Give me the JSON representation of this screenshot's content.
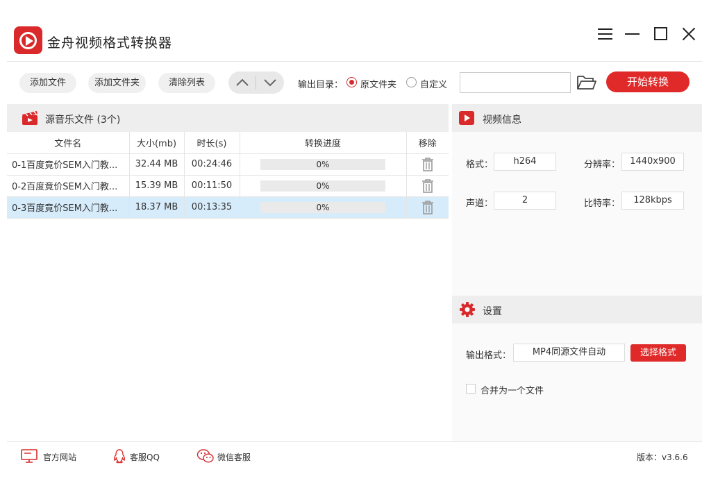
{
  "app": {
    "title": "金舟视频格式转换器"
  },
  "toolbar": {
    "add_file": "添加文件",
    "add_folder": "添加文件夹",
    "clear_list": "清除列表",
    "output_dir_label": "输出目录：",
    "radio_original": "原文件夹",
    "radio_custom": "自定义",
    "output_path": "",
    "start": "开始转换"
  },
  "file_panel": {
    "title": "源音乐文件 (3个)",
    "columns": [
      "文件名",
      "大小(mb)",
      "时长(s)",
      "转换进度",
      "移除"
    ],
    "rows": [
      {
        "name": "0-1百度竟价SEM入门教...",
        "size": "32.44 MB",
        "duration": "00:24:46",
        "progress_pct": 0,
        "progress": "0%"
      },
      {
        "name": "0-2百度竟价SEM入门教...",
        "size": "15.39 MB",
        "duration": "00:11:50",
        "progress_pct": 0,
        "progress": "0%"
      },
      {
        "name": "0-3百度竟价SEM入门教...",
        "size": "18.37 MB",
        "duration": "00:13:35",
        "progress_pct": 0,
        "progress": "0%"
      }
    ],
    "selected_row": 2
  },
  "video_info": {
    "title": "视频信息",
    "format_label": "格式：",
    "format_value": "h264",
    "resolution_label": "分辨率：",
    "resolution_value": "1440x900",
    "channel_label": "声道：",
    "channel_value": "2",
    "bitrate_label": "比特率：",
    "bitrate_value": "128kbps"
  },
  "settings": {
    "title": "设置",
    "output_format_label": "输出格式：",
    "output_format_value": "MP4同源文件自动",
    "choose_format": "选择格式",
    "merge_label": "合并为一个文件",
    "merge_checked": false
  },
  "footer": {
    "website": "官方网站",
    "qq": "客服QQ",
    "wechat": "微信客服",
    "version": "版本：v3.6.6"
  },
  "colors": {
    "accent": "#e02a2a",
    "selected_row": "#d7ecfb",
    "header_bg": "#eeeeee"
  }
}
